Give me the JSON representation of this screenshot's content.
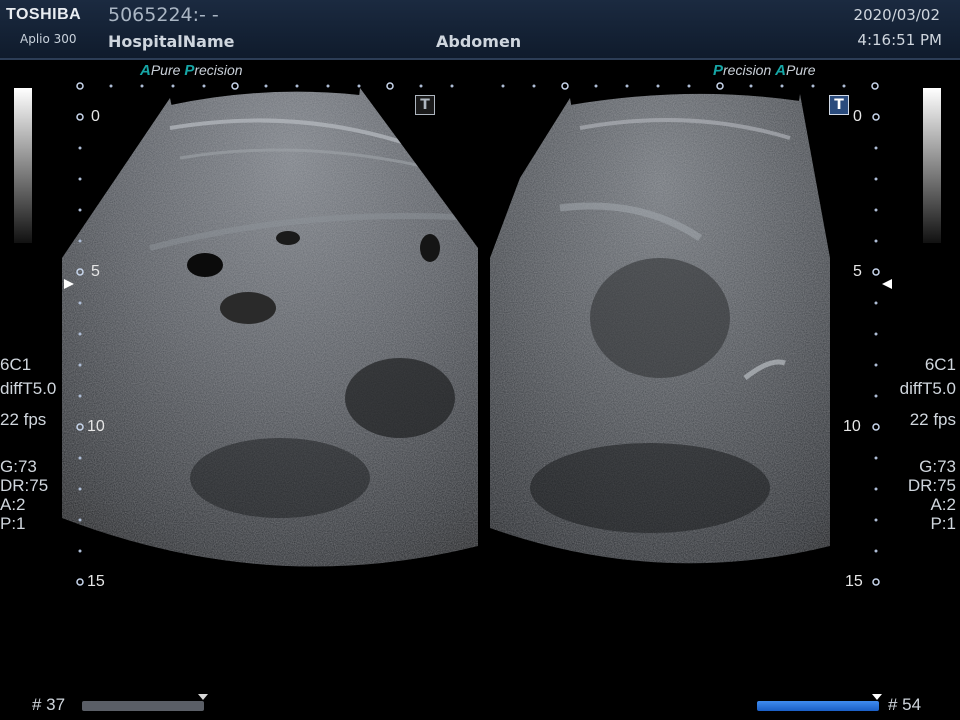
{
  "header": {
    "brand": "TOSHIBA",
    "model": "Aplio 300",
    "patient_id": "5065224:- -",
    "hospital": "HospitalName",
    "exam": "Abdomen",
    "date": "2020/03/02",
    "time": "4:16:51 PM"
  },
  "left_panel": {
    "tag_a": "A",
    "tag_pure": "Pure",
    "tag_p": "P",
    "tag_precision": "recision",
    "depth_marks": [
      "0",
      "5",
      "10",
      "15"
    ],
    "info": [
      "6C1",
      "diffT5.0",
      "22 fps",
      "G:73",
      "DR:75",
      "A:2",
      "P:1"
    ],
    "frame_label": "# 37",
    "cine_position": 0.0
  },
  "right_panel": {
    "tag_p": "P",
    "tag_precision": "recision",
    "tag_a": "A",
    "tag_pure": "Pure",
    "depth_marks": [
      "0",
      "5",
      "10",
      "15"
    ],
    "info": [
      "6C1",
      "diffT5.0",
      "22 fps",
      "G:73",
      "DR:75",
      "A:2",
      "P:1"
    ],
    "frame_label": "# 54",
    "cine_position": 1.0
  },
  "t_button": "T",
  "colors": {
    "header_bg": "#15243a",
    "brand_accent": "#16a6a6",
    "cine_active": "#1f6fd6",
    "cine_inactive": "#5a5e66"
  }
}
